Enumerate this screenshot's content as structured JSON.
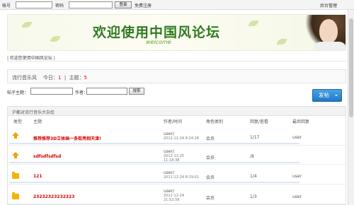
{
  "topbar": {
    "account_label": "帐号",
    "password_label": "密码",
    "login_button": "登录",
    "register_link": "免费注册",
    "admin_link": "后台管理"
  },
  "banner": {
    "title": "欢迎使用中国风论坛",
    "subtitle": "welcome"
  },
  "welcome_text": "| 欢迎您使用中国风论坛 |",
  "stats": {
    "forum_name": "流行音乐风",
    "today_label": "今日：",
    "today_value": "1",
    "topics_label": "主题：",
    "topics_value": "5"
  },
  "search": {
    "title_label": "帖子主题：",
    "author_label": "作者：",
    "button": "搜索"
  },
  "post_button": "发帖",
  "board": {
    "header": "沪都对流行音乐大杂烩",
    "columns": [
      "类型",
      "主题",
      "作者/时间",
      "角色类别",
      "回复/查看",
      "最后回复"
    ],
    "rows": [
      {
        "icon": "up-arrow-icon",
        "title": "推荐推荐3D立体画一条街亮相天津!",
        "author": "user/",
        "time": "2012-12-24 8:24:28",
        "role": "会员",
        "replies": "1/17",
        "last": "user"
      },
      {
        "icon": "up-arrow-icon",
        "title": "sdfsdfsdfsd",
        "author": "user/",
        "time": "2012-12-25 11:18:38",
        "role": "会员",
        "replies": "/8",
        "last": ""
      },
      {
        "icon": "folder-icon",
        "title": "121",
        "author": "user/",
        "time": "2012-12-24 8:19:01",
        "role": "会员",
        "replies": "1/4",
        "last": "user"
      },
      {
        "icon": "folder-icon",
        "title": "23232323232323",
        "author": "user/",
        "time": "2012-12-24 21:52:56",
        "role": "会员",
        "replies": "1/3",
        "last": "user"
      }
    ]
  },
  "colors": {
    "title_red": "#d90000",
    "banner_green": "#2f7a1c",
    "button_blue": "#1f78c8",
    "icon_orange": "#f4a000"
  }
}
